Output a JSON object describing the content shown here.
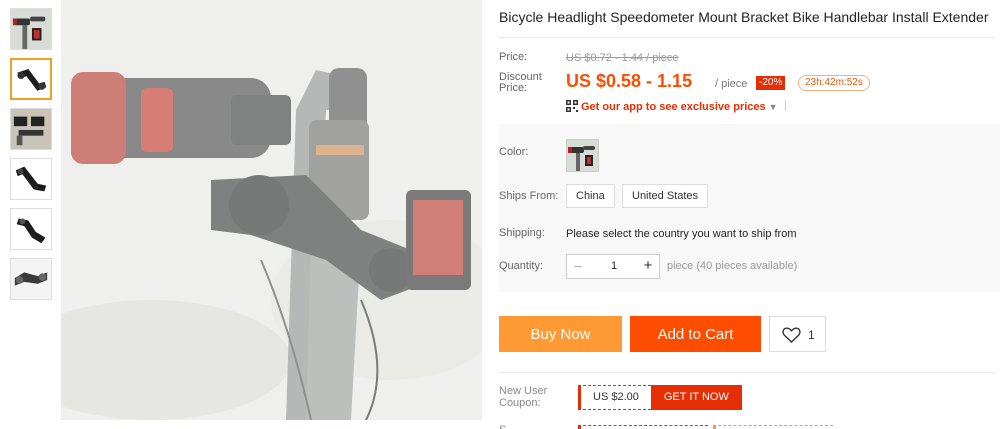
{
  "product": {
    "title": "Bicycle Headlight Speedometer Mount Bracket Bike Handlebar Install Extender"
  },
  "gallery": {
    "thumbnails": [
      {
        "name": "thumb-bike-front"
      },
      {
        "name": "thumb-bracket-black"
      },
      {
        "name": "thumb-bracket-mounted"
      },
      {
        "name": "thumb-bracket-angle"
      },
      {
        "name": "thumb-bracket-side"
      },
      {
        "name": "thumb-bracket-gray"
      }
    ],
    "active_index": 1
  },
  "pricing": {
    "price_label": "Price:",
    "original_price": "US $0.72 - 1.44 / piece",
    "discount_label": "Discount Price:",
    "discount_price": "US $0.58 - 1.15",
    "per_unit": "/ piece",
    "discount_badge": "-20%",
    "countdown": "23h:42m:52s",
    "app_promo": "Get our app to see exclusive prices",
    "app_promo_caret": "▼"
  },
  "options": {
    "color_label": "Color:",
    "ships_from_label": "Ships From:",
    "ships_from": [
      "China",
      "United States"
    ],
    "shipping_label": "Shipping:",
    "shipping_text": "Please select the country you want to ship from",
    "quantity_label": "Quantity:",
    "quantity_value": "1",
    "quantity_minus": "−",
    "quantity_plus": "+",
    "quantity_note": "piece (40 pieces available)"
  },
  "actions": {
    "buy_now": "Buy Now",
    "add_to_cart": "Add to Cart",
    "wishlist_count": "1"
  },
  "coupon": {
    "label": "New User Coupon:",
    "amount": "US $2.00",
    "cta": "GET IT NOW",
    "next_label": "S"
  },
  "colors": {
    "accent": "#ff4d00",
    "buy_now": "#ff9933",
    "coupon": "#e62e04",
    "active_thumb_border": "#f0a020"
  }
}
